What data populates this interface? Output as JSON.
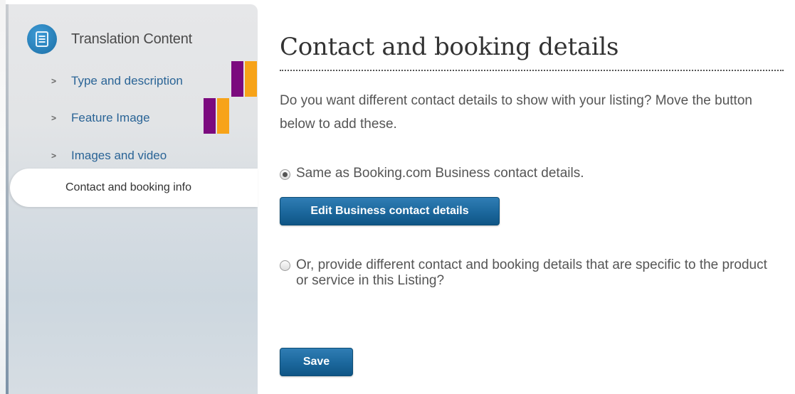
{
  "sidebar": {
    "header": {
      "title": "Translation Content",
      "icon": "document-icon"
    },
    "items": [
      {
        "label": "Type and description",
        "icon": "chevron-right-icon"
      },
      {
        "label": "Feature Image",
        "icon": "chevron-right-icon"
      },
      {
        "label": "Images and video",
        "icon": "chevron-right-icon"
      }
    ],
    "active_item": {
      "label": "Contact and booking info"
    },
    "marker_colors": {
      "purple": "#7b0a7e",
      "orange": "#f7a319"
    }
  },
  "main": {
    "title": "Contact and booking details",
    "intro": "Do you want different contact details to show with your listing? Move the button below to add these.",
    "options": [
      {
        "label": "Same as Booking.com Business contact details.",
        "selected": true
      },
      {
        "label": "Or, provide different contact and booking details that are specific to the product or service in this Listing?",
        "selected": false
      }
    ],
    "edit_button_label": "Edit Business contact details",
    "save_button_label": "Save"
  },
  "colors": {
    "accent": "#1b679c",
    "link": "#2a6496"
  }
}
